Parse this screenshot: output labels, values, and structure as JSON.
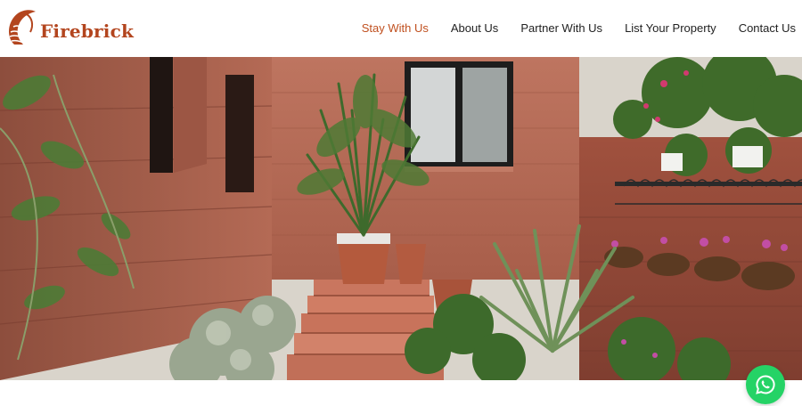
{
  "brand": {
    "name": "Firebrick",
    "color": "#b3451e",
    "logo_icon": "flame-sun-icon"
  },
  "nav": {
    "active_color": "#c0501f",
    "items": [
      {
        "label": "Stay With Us",
        "active": true
      },
      {
        "label": "About Us",
        "active": false
      },
      {
        "label": "Partner With Us",
        "active": false
      },
      {
        "label": "List Your Property",
        "active": false
      },
      {
        "label": "Contact Us",
        "active": false
      }
    ]
  },
  "hero": {
    "description_icon": "courtyard-photo",
    "colors": {
      "brick": "#b06650",
      "foliage": "#3f6b2a"
    }
  },
  "floating_action": {
    "icon": "whatsapp-icon",
    "color": "#25d366"
  }
}
